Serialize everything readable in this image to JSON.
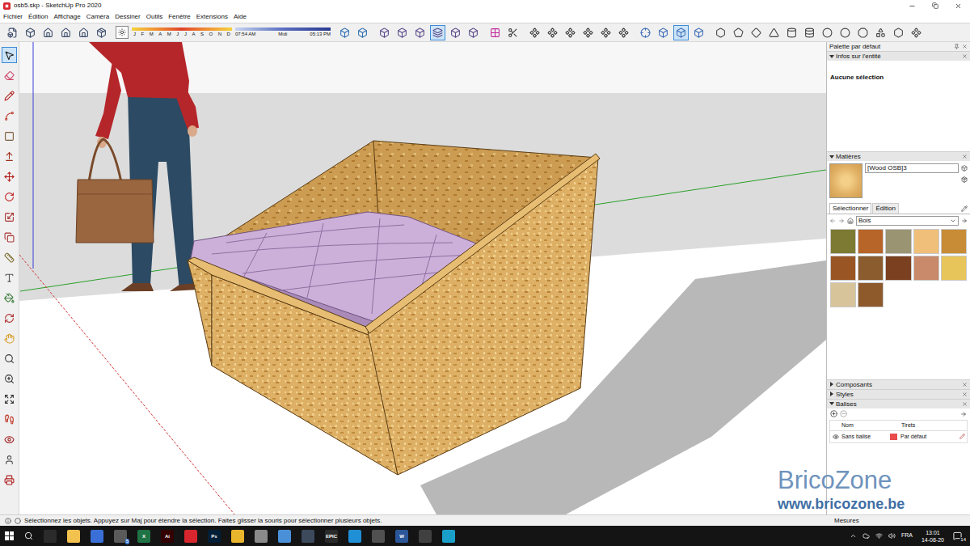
{
  "window": {
    "title": "osb5.skp - SketchUp Pro 2020"
  },
  "menu": [
    "Fichier",
    "Édition",
    "Affichage",
    "Caméra",
    "Dessiner",
    "Outils",
    "Fenêtre",
    "Extensions",
    "Aide"
  ],
  "top_toolbar": {
    "groups": [
      [
        {
          "selected": false
        },
        {
          "selected": false
        },
        {
          "selected": false
        },
        {
          "selected": false
        },
        {
          "selected": false
        },
        {
          "selected": false
        }
      ],
      [
        {
          "selected": false
        },
        {
          "selected": false
        }
      ],
      [
        {
          "selected": false
        },
        {
          "selected": false
        },
        {
          "selected": false
        },
        {
          "selected": true
        },
        {
          "selected": false
        },
        {
          "selected": false
        }
      ],
      [
        {
          "selected": false
        },
        {
          "selected": false
        }
      ],
      [
        {
          "selected": false
        },
        {
          "selected": false
        },
        {
          "selected": false
        },
        {
          "selected": false
        },
        {
          "selected": false
        },
        {
          "selected": false
        }
      ],
      [
        {
          "selected": false
        },
        {
          "selected": false
        },
        {
          "selected": true
        },
        {
          "selected": false
        }
      ],
      [
        {
          "selected": false
        },
        {
          "selected": false
        },
        {
          "selected": false
        },
        {
          "selected": false
        },
        {
          "selected": false
        },
        {
          "selected": false
        },
        {
          "selected": false
        },
        {
          "selected": false
        },
        {
          "selected": false
        },
        {
          "selected": false
        },
        {
          "selected": false
        },
        {
          "selected": false
        }
      ]
    ]
  },
  "shadows": {
    "months": [
      "J",
      "F",
      "M",
      "A",
      "M",
      "J",
      "J",
      "A",
      "S",
      "O",
      "N",
      "D"
    ],
    "time_start": "07:54 AM",
    "noon": "Midi",
    "time_end": "05:13 PM"
  },
  "left_toolbar": {
    "tools": [
      {
        "selected": true
      },
      {
        "selected": false
      },
      {
        "selected": false
      },
      {
        "selected": false
      },
      {
        "selected": false
      },
      {
        "selected": false
      },
      {
        "selected": false
      },
      {
        "selected": false
      },
      {
        "selected": false
      },
      {
        "selected": false
      },
      {
        "selected": false
      },
      {
        "selected": false
      },
      {
        "selected": false
      },
      {
        "selected": false
      },
      {
        "selected": false
      },
      {
        "selected": false
      },
      {
        "selected": false
      },
      {
        "selected": false
      },
      {
        "selected": false
      },
      {
        "selected": false
      },
      {
        "selected": false
      },
      {
        "selected": false
      }
    ]
  },
  "panel": {
    "title": "Palette par défaut",
    "entity_info": {
      "title": "Infos sur l'entité",
      "expanded": true,
      "text": "Aucune sélection"
    },
    "materials": {
      "title": "Matières",
      "expanded": true,
      "name": "[Wood OSB]3",
      "tabs": [
        {
          "label": "Sélectionner",
          "selected": true
        },
        {
          "label": "Édition",
          "selected": false
        }
      ],
      "library": "Bois",
      "swatches": [
        {
          "color": "#7d7a34"
        },
        {
          "color": "#b8652a"
        },
        {
          "color": "#9b9473"
        },
        {
          "color": "#f0c07a"
        },
        {
          "color": "#c98c36"
        },
        {
          "color": "#9a5524"
        },
        {
          "color": "#8a5c2e"
        },
        {
          "color": "#7a4020"
        },
        {
          "color": "#c88a6a"
        },
        {
          "color": "#e8c55a"
        },
        {
          "color": "#d8c49a"
        },
        {
          "color": "#8e5a2c"
        }
      ]
    },
    "collapsed": [
      {
        "title": "Composants",
        "expanded": false
      },
      {
        "title": "Styles",
        "expanded": false
      }
    ],
    "tags": {
      "title": "Balises",
      "expanded": true,
      "columns": [
        "Nom",
        "Tirets"
      ],
      "rows": [
        {
          "name": "Sans balise",
          "dashes": "Par défaut",
          "visible": true,
          "color": "#e84c4c"
        }
      ]
    }
  },
  "status_bar": {
    "text": "Sélectionnez les objets. Appuyez sur Maj pour étendre la sélection. Faites glisser la souris pour sélectionner plusieurs objets.",
    "measure_label": "Mesures"
  },
  "watermark": {
    "title": "BricoZone",
    "url": "www.bricozone.be"
  },
  "taskbar": {
    "apps": [
      {
        "glyph": "",
        "color": "#2b2b2b",
        "badge": ""
      },
      {
        "glyph": "",
        "color": "#f2c14e",
        "badge": ""
      },
      {
        "glyph": "",
        "color": "#3a6fd8",
        "badge": ""
      },
      {
        "glyph": "",
        "color": "#5a5a5a",
        "badge": "5"
      },
      {
        "glyph": "X",
        "color": "#1f7244",
        "badge": ""
      },
      {
        "glyph": "Ai",
        "color": "#330000",
        "badge": ""
      },
      {
        "glyph": "",
        "color": "#d8262f",
        "badge": ""
      },
      {
        "glyph": "Ps",
        "color": "#001e36",
        "badge": ""
      },
      {
        "glyph": "",
        "color": "#e9b52c",
        "badge": ""
      },
      {
        "glyph": "",
        "color": "#8a8a8a",
        "badge": ""
      },
      {
        "glyph": "",
        "color": "#4a90d9",
        "badge": ""
      },
      {
        "glyph": "",
        "color": "#3c4a5c",
        "badge": ""
      },
      {
        "glyph": "EPIC",
        "color": "#2a2a2a",
        "badge": ""
      },
      {
        "glyph": "",
        "color": "#1f8fd6",
        "badge": ""
      },
      {
        "glyph": "",
        "color": "#505050",
        "badge": ""
      },
      {
        "glyph": "W",
        "color": "#2b579a",
        "badge": ""
      },
      {
        "glyph": "",
        "color": "#404040",
        "badge": ""
      },
      {
        "glyph": "",
        "color": "#1aa0c8",
        "badge": ""
      }
    ],
    "language": "FRA",
    "time": "13:01",
    "date": "14-08-20",
    "notifications": "14"
  }
}
